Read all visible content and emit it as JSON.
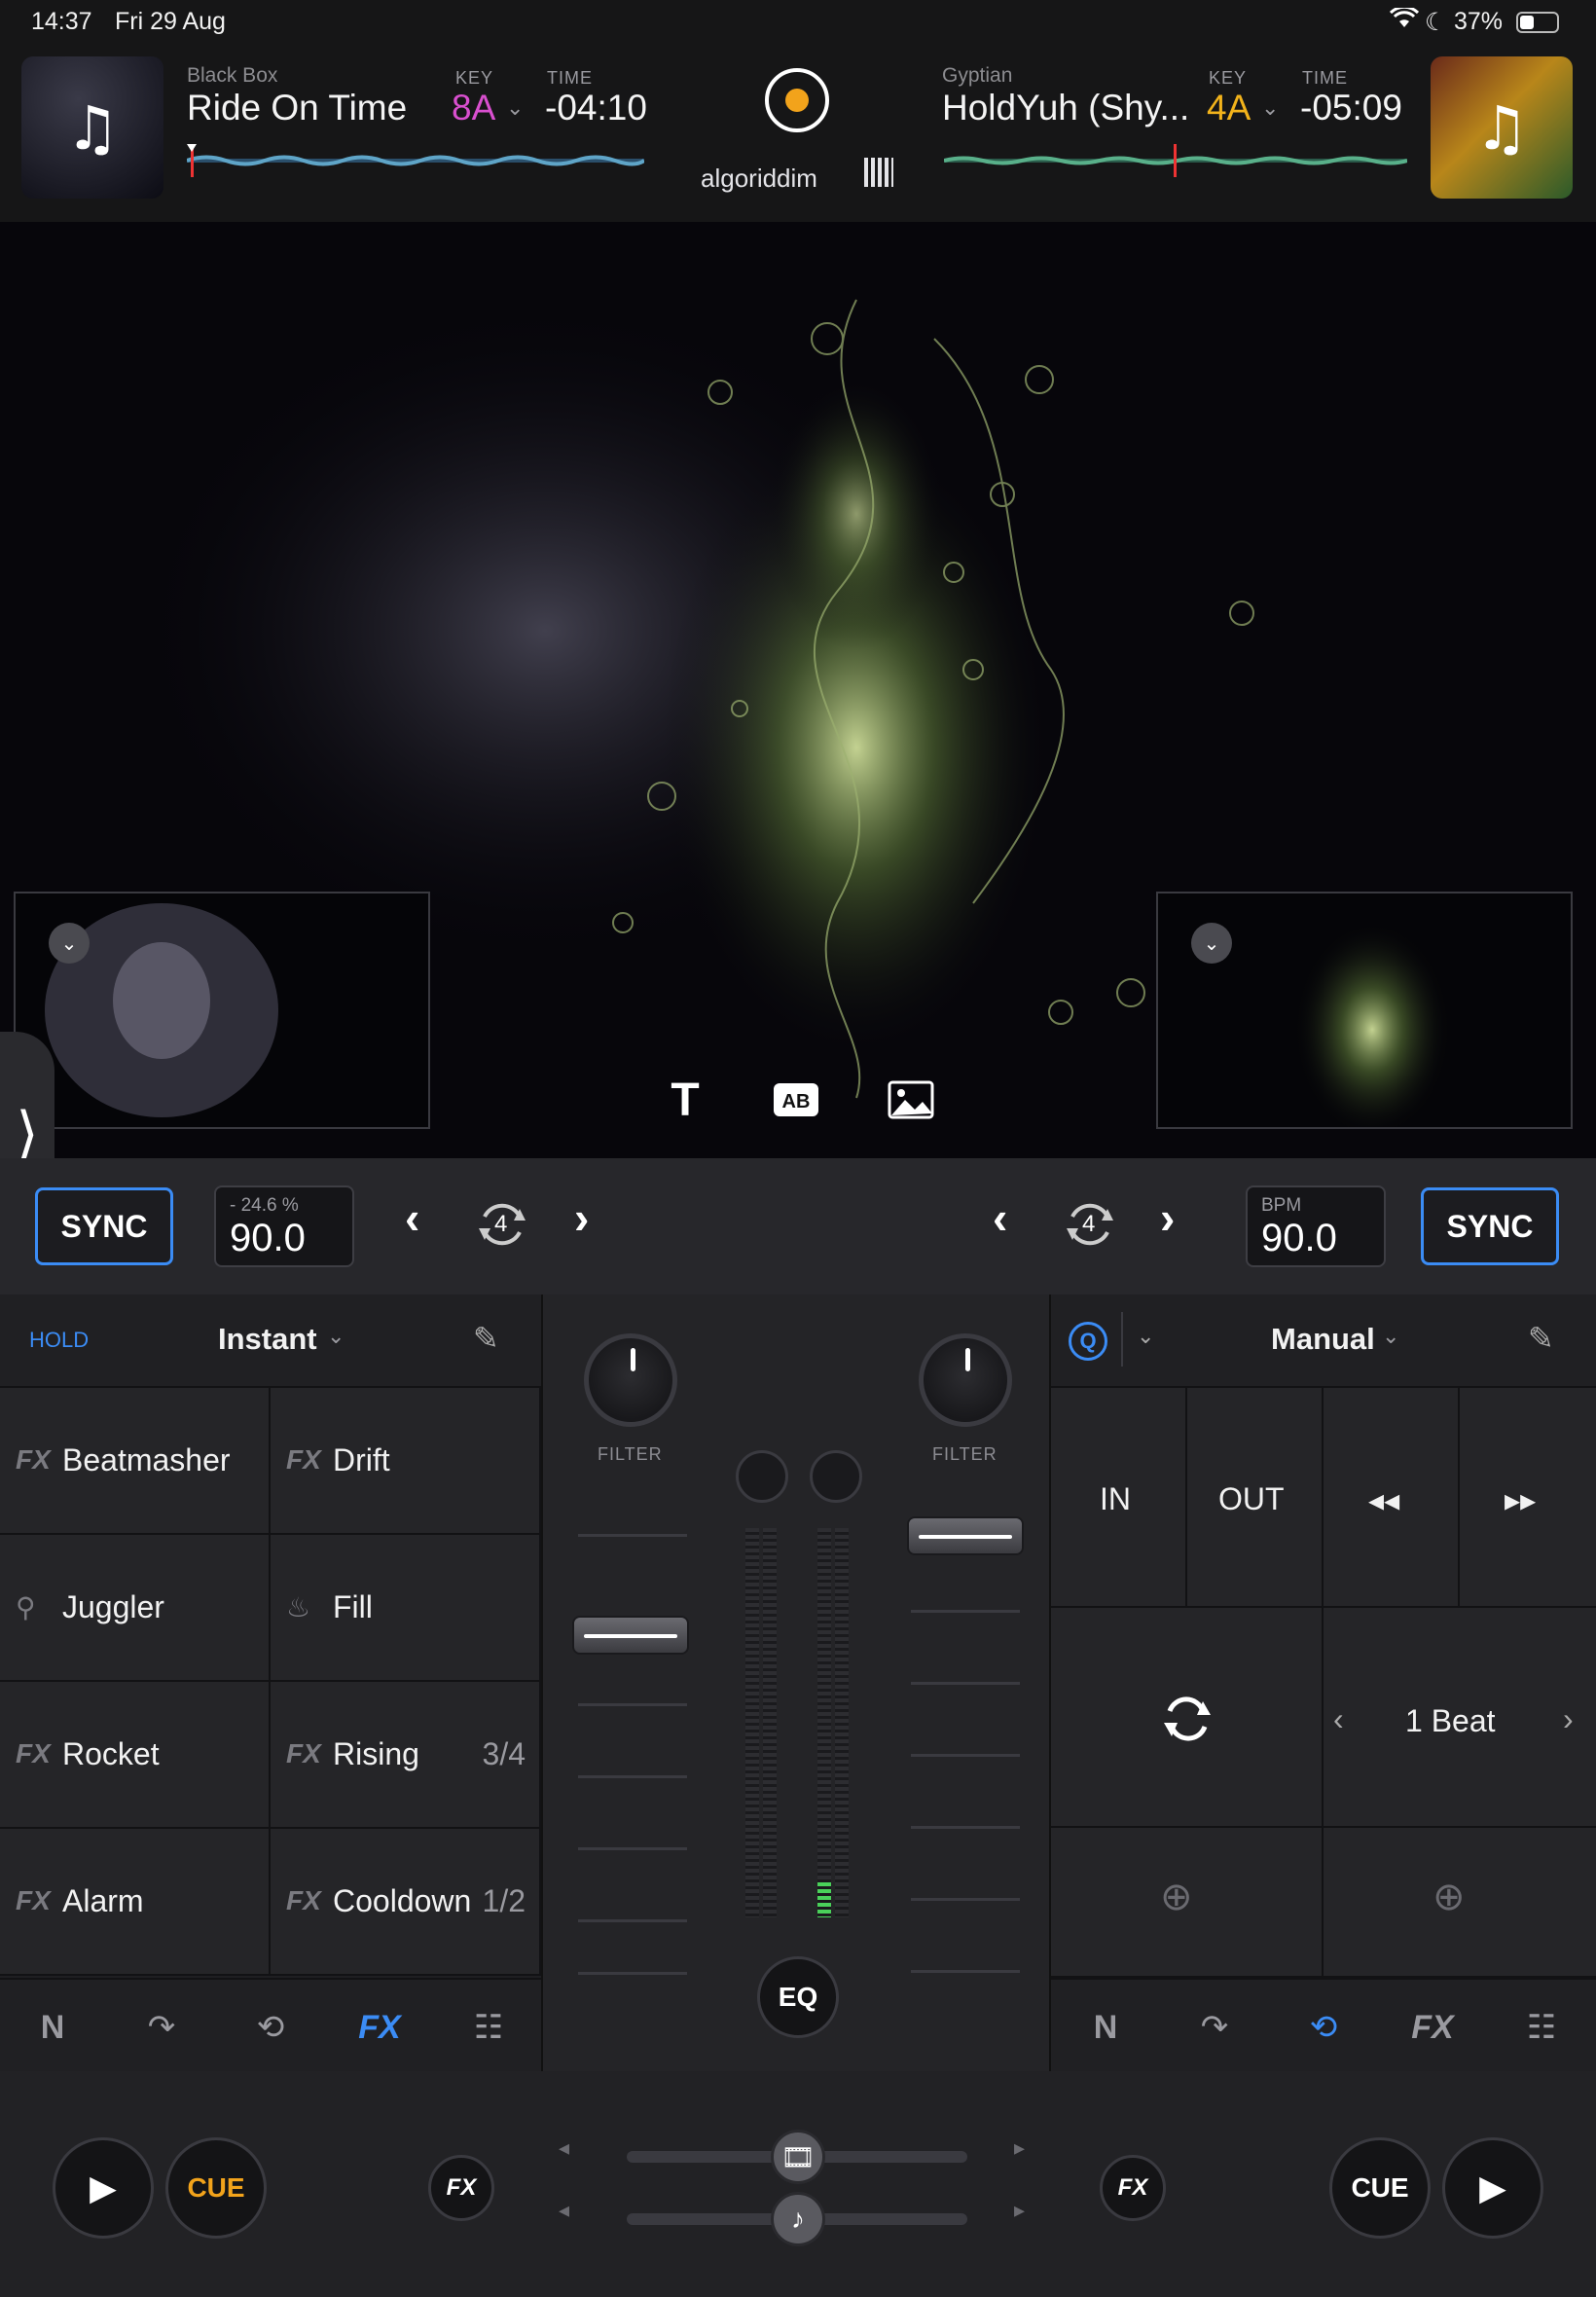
{
  "status_bar": {
    "time": "14:37",
    "date": "Fri 29 Aug",
    "battery": "37%"
  },
  "deck_left": {
    "artist": "Black Box",
    "title": "Ride On Time",
    "key_label": "KEY",
    "key": "8A",
    "key_color": "#d94fcf",
    "time_label": "TIME",
    "time": "-04:10",
    "pitch": "- 24.6 %",
    "bpm": "90.0",
    "sync_label": "SYNC",
    "loop_beats": "4"
  },
  "deck_right": {
    "artist": "Gyptian",
    "title": "HoldYuh (Shy...",
    "key_label": "KEY",
    "key": "4A",
    "key_color": "#f2b31b",
    "time_label": "TIME",
    "time": "-05:09",
    "bpm_label": "BPM",
    "bpm": "90.0",
    "sync_label": "SYNC",
    "loop_beats": "4"
  },
  "brand": "algoriddim",
  "fx_panel": {
    "hold_label": "HOLD",
    "mode": "Instant",
    "pads": [
      {
        "prefix": "FX",
        "name": "Beatmasher",
        "count": ""
      },
      {
        "prefix": "FX",
        "name": "Drift",
        "count": ""
      },
      {
        "prefix": "",
        "name": "Juggler",
        "count": ""
      },
      {
        "prefix": "",
        "name": "Fill",
        "count": ""
      },
      {
        "prefix": "FX",
        "name": "Rocket",
        "count": ""
      },
      {
        "prefix": "FX",
        "name": "Rising",
        "count": "3/4"
      },
      {
        "prefix": "FX",
        "name": "Alarm",
        "count": ""
      },
      {
        "prefix": "FX",
        "name": "Cooldown",
        "count": "1/2"
      }
    ]
  },
  "mixer": {
    "filter_label": "FILTER",
    "eq_label": "EQ"
  },
  "loop_panel": {
    "mode": "Manual",
    "in_label": "IN",
    "out_label": "OUT",
    "beat_label": "1 Beat"
  },
  "bottom": {
    "cue_label": "CUE",
    "fx_label": "FX"
  },
  "colors": {
    "accent_blue": "#3b8cf5",
    "cue_orange": "#f2a31b",
    "active_tab": "#3b8cf5"
  }
}
